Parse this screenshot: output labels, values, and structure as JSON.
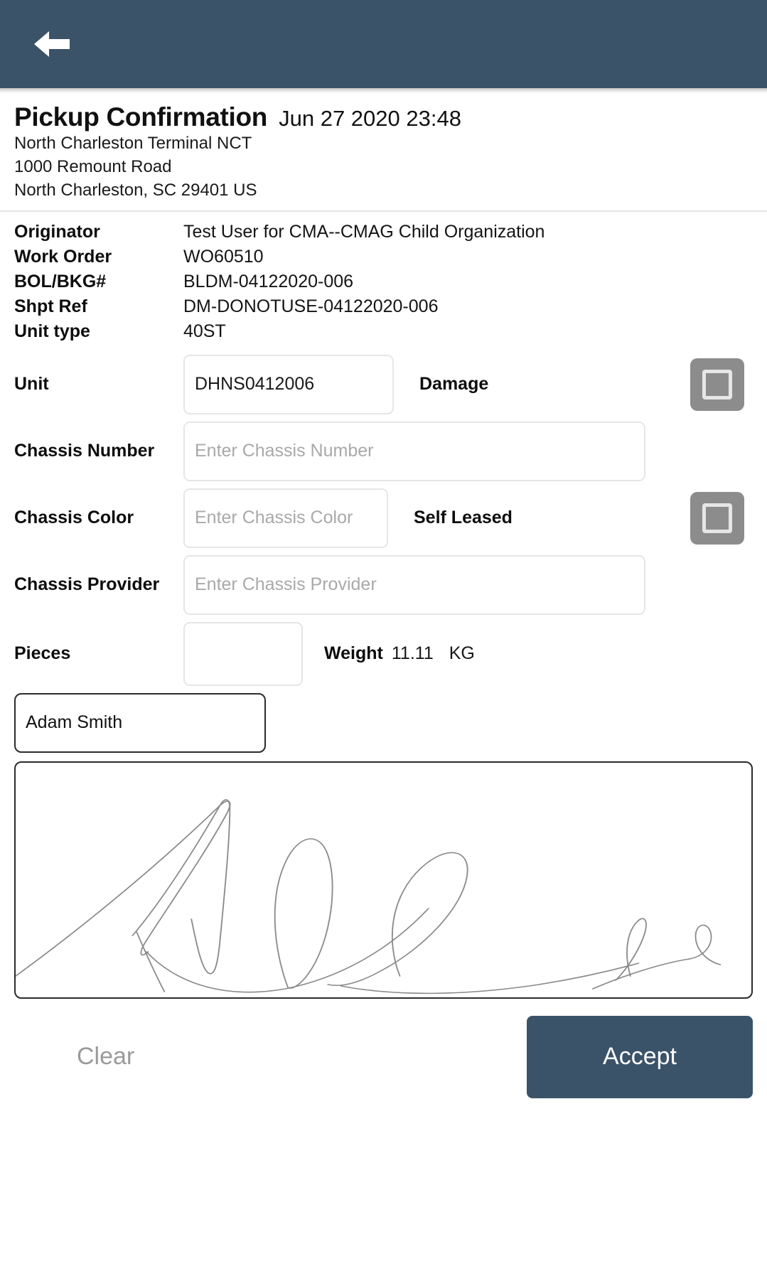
{
  "appbar": {
    "back_icon": "arrow-left-icon",
    "background": "#3b5369"
  },
  "header": {
    "title": "Pickup Confirmation",
    "date": "Jun 27 2020 23:48",
    "terminal": "North Charleston Terminal NCT",
    "street": "1000 Remount Road",
    "city_state_zip": "North Charleston, SC 29401 US"
  },
  "info": {
    "rows": [
      {
        "label": "Originator",
        "value": "Test User for CMA--CMAG Child Organization"
      },
      {
        "label": "Work Order",
        "value": "WO60510"
      },
      {
        "label": "BOL/BKG#",
        "value": "BLDM-04122020-006"
      },
      {
        "label": "Shpt Ref",
        "value": "DM-DONOTUSE-04122020-006"
      },
      {
        "label": "Unit type",
        "value": "40ST"
      }
    ]
  },
  "form": {
    "unit": {
      "label": "Unit",
      "value": "DHNS0412006",
      "placeholder": "",
      "toggle_label": "Damage",
      "toggle_checked": false
    },
    "chassis_number": {
      "label": "Chassis Number",
      "value": "",
      "placeholder": "Enter Chassis Number"
    },
    "chassis_color": {
      "label": "Chassis Color",
      "value": "",
      "placeholder": "Enter Chassis Color",
      "toggle_label": "Self Leased",
      "toggle_checked": false
    },
    "chassis_provider": {
      "label": "Chassis Provider",
      "value": "",
      "placeholder": "Enter Chassis Provider"
    },
    "pieces": {
      "label": "Pieces",
      "value": "",
      "placeholder": ""
    },
    "weight": {
      "label": "Weight",
      "value": "11.11",
      "uom": "KG"
    }
  },
  "signature": {
    "name_value": "Adam Smith",
    "name_placeholder": "",
    "pad_name": "signature-pad"
  },
  "actions": {
    "clear_label": "Clear",
    "accept_label": "Accept",
    "accept_color": "#3b5369",
    "clear_color": "#9a9a9a"
  }
}
